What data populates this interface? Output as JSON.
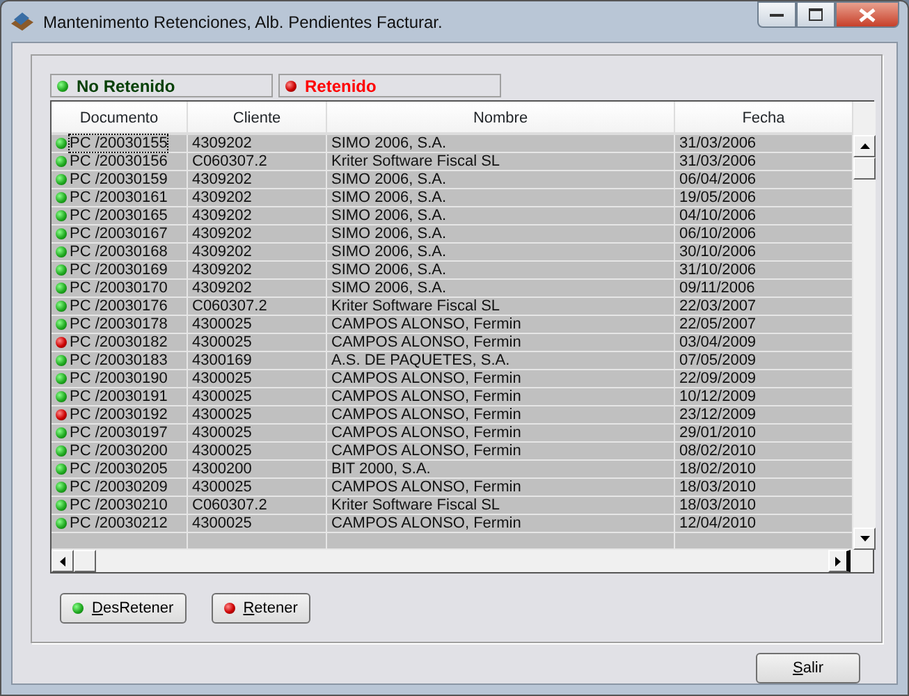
{
  "window": {
    "title": "Mantenimento Retenciones, Alb. Pendientes Facturar."
  },
  "legend": [
    {
      "label": "No Retenido",
      "retained": false
    },
    {
      "label": "Retenido",
      "retained": true
    }
  ],
  "table": {
    "columns": [
      "Documento",
      "Cliente",
      "Nombre",
      "Fecha"
    ],
    "rows": [
      {
        "cells": [
          "PC /20030155",
          "4309202",
          "SIMO 2006, S.A.",
          "31/03/2006"
        ],
        "retained": false,
        "focused": true
      },
      {
        "cells": [
          "PC /20030156",
          "C060307.2",
          "Kriter Software Fiscal SL",
          "31/03/2006"
        ],
        "retained": false,
        "focused": false
      },
      {
        "cells": [
          "PC /20030159",
          "4309202",
          "SIMO 2006, S.A.",
          "06/04/2006"
        ],
        "retained": false,
        "focused": false
      },
      {
        "cells": [
          "PC /20030161",
          "4309202",
          "SIMO 2006, S.A.",
          "19/05/2006"
        ],
        "retained": false,
        "focused": false
      },
      {
        "cells": [
          "PC /20030165",
          "4309202",
          "SIMO 2006, S.A.",
          "04/10/2006"
        ],
        "retained": false,
        "focused": false
      },
      {
        "cells": [
          "PC /20030167",
          "4309202",
          "SIMO 2006, S.A.",
          "06/10/2006"
        ],
        "retained": false,
        "focused": false
      },
      {
        "cells": [
          "PC /20030168",
          "4309202",
          "SIMO 2006, S.A.",
          "30/10/2006"
        ],
        "retained": false,
        "focused": false
      },
      {
        "cells": [
          "PC /20030169",
          "4309202",
          "SIMO 2006, S.A.",
          "31/10/2006"
        ],
        "retained": false,
        "focused": false
      },
      {
        "cells": [
          "PC /20030170",
          "4309202",
          "SIMO 2006, S.A.",
          "09/11/2006"
        ],
        "retained": false,
        "focused": false
      },
      {
        "cells": [
          "PC /20030176",
          "C060307.2",
          "Kriter Software Fiscal SL",
          "22/03/2007"
        ],
        "retained": false,
        "focused": false
      },
      {
        "cells": [
          "PC /20030178",
          "4300025",
          "CAMPOS ALONSO, Fermin",
          "22/05/2007"
        ],
        "retained": false,
        "focused": false
      },
      {
        "cells": [
          "PC /20030182",
          "4300025",
          "CAMPOS ALONSO, Fermin",
          "03/04/2009"
        ],
        "retained": true,
        "focused": false
      },
      {
        "cells": [
          "PC /20030183",
          "4300169",
          "A.S. DE PAQUETES, S.A.",
          "07/05/2009"
        ],
        "retained": false,
        "focused": false
      },
      {
        "cells": [
          "PC /20030190",
          "4300025",
          "CAMPOS ALONSO, Fermin",
          "22/09/2009"
        ],
        "retained": false,
        "focused": false
      },
      {
        "cells": [
          "PC /20030191",
          "4300025",
          "CAMPOS ALONSO, Fermin",
          "10/12/2009"
        ],
        "retained": false,
        "focused": false
      },
      {
        "cells": [
          "PC /20030192",
          "4300025",
          "CAMPOS ALONSO, Fermin",
          "23/12/2009"
        ],
        "retained": true,
        "focused": false
      },
      {
        "cells": [
          "PC /20030197",
          "4300025",
          "CAMPOS ALONSO, Fermin",
          "29/01/2010"
        ],
        "retained": false,
        "focused": false
      },
      {
        "cells": [
          "PC /20030200",
          "4300025",
          "CAMPOS ALONSO, Fermin",
          "08/02/2010"
        ],
        "retained": false,
        "focused": false
      },
      {
        "cells": [
          "PC /20030205",
          "4300200",
          "BIT 2000, S.A.",
          "18/02/2010"
        ],
        "retained": false,
        "focused": false
      },
      {
        "cells": [
          "PC /20030209",
          "4300025",
          "CAMPOS ALONSO, Fermin",
          "18/03/2010"
        ],
        "retained": false,
        "focused": false
      },
      {
        "cells": [
          "PC /20030210",
          "C060307.2",
          "Kriter Software Fiscal SL",
          "18/03/2010"
        ],
        "retained": false,
        "focused": false
      },
      {
        "cells": [
          "PC /20030212",
          "4300025",
          "CAMPOS ALONSO, Fermin",
          "12/04/2010"
        ],
        "retained": false,
        "focused": false
      }
    ]
  },
  "actions": [
    {
      "label": "DesRetener",
      "retained": false
    },
    {
      "label": "Retener",
      "retained": true
    }
  ],
  "footer_button": "Salir"
}
